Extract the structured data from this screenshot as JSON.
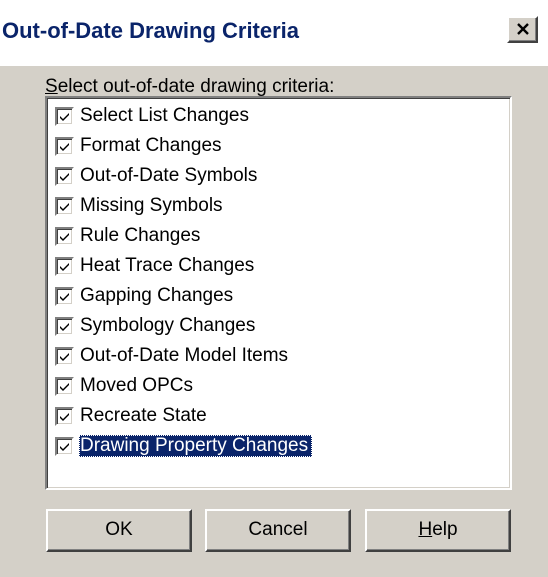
{
  "window": {
    "title": "Out-of-Date Drawing Criteria",
    "close_glyph": "✕",
    "close_icon": "close-icon"
  },
  "prompt": {
    "accel": "S",
    "rest": "elect out-of-date drawing criteria:"
  },
  "criteria": {
    "items": [
      {
        "label": "Select List Changes",
        "checked": true
      },
      {
        "label": "Format Changes",
        "checked": true
      },
      {
        "label": "Out-of-Date Symbols",
        "checked": true
      },
      {
        "label": "Missing Symbols",
        "checked": true
      },
      {
        "label": "Rule Changes",
        "checked": true
      },
      {
        "label": "Heat Trace Changes",
        "checked": true
      },
      {
        "label": "Gapping Changes",
        "checked": true
      },
      {
        "label": "Symbology Changes",
        "checked": true
      },
      {
        "label": "Out-of-Date Model Items",
        "checked": true
      },
      {
        "label": "Moved OPCs",
        "checked": true
      },
      {
        "label": "Recreate State",
        "checked": true
      },
      {
        "label": "Drawing Property Changes",
        "checked": true,
        "selected": true
      }
    ]
  },
  "buttons": {
    "ok": "OK",
    "cancel": "Cancel",
    "help_accel": "H",
    "help_rest": "elp"
  },
  "colors": {
    "selection": "#0a246a",
    "title_text": "#0a246a",
    "face": "#d4d0c8"
  }
}
